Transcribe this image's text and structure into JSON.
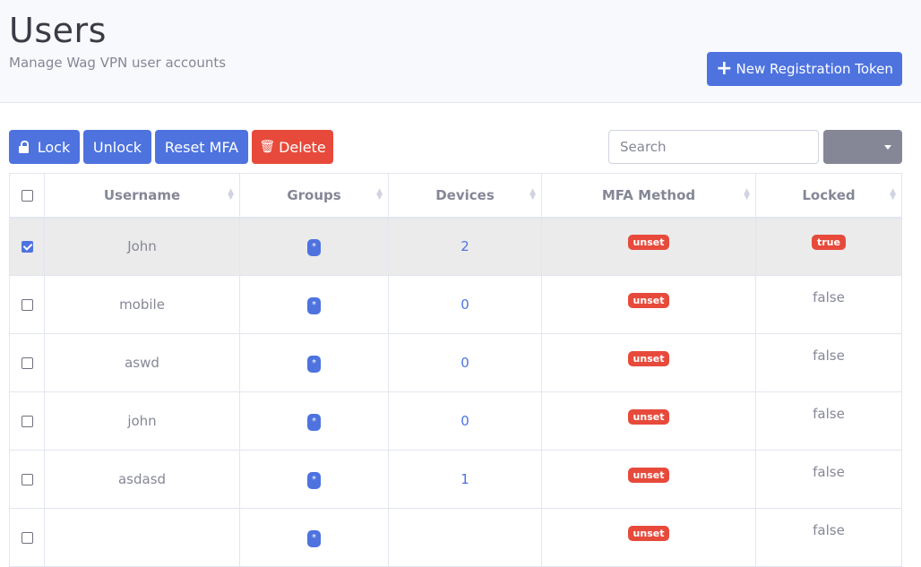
{
  "header": {
    "title": "Users",
    "subtitle": "Manage Wag VPN user accounts",
    "new_token_label": "New Registration Token"
  },
  "toolbar": {
    "lock_label": "Lock",
    "unlock_label": "Unlock",
    "reset_mfa_label": "Reset MFA",
    "delete_label": "Delete",
    "search_placeholder": "Search"
  },
  "table": {
    "columns": [
      "Username",
      "Groups",
      "Devices",
      "MFA Method",
      "Locked"
    ],
    "rows": [
      {
        "selected": true,
        "username": "John",
        "groups": "*",
        "devices": "2",
        "mfa": "unset",
        "locked": "true"
      },
      {
        "selected": false,
        "username": "mobile",
        "groups": "*",
        "devices": "0",
        "mfa": "unset",
        "locked": "false"
      },
      {
        "selected": false,
        "username": "aswd",
        "groups": "*",
        "devices": "0",
        "mfa": "unset",
        "locked": "false"
      },
      {
        "selected": false,
        "username": "john",
        "groups": "*",
        "devices": "0",
        "mfa": "unset",
        "locked": "false"
      },
      {
        "selected": false,
        "username": "asdasd",
        "groups": "*",
        "devices": "1",
        "mfa": "unset",
        "locked": "false"
      },
      {
        "selected": false,
        "username": "",
        "groups": "*",
        "devices": "",
        "mfa": "unset",
        "locked": "false"
      }
    ]
  },
  "colors": {
    "primary": "#4e73df",
    "danger": "#e74a3b",
    "secondary": "#858796"
  }
}
